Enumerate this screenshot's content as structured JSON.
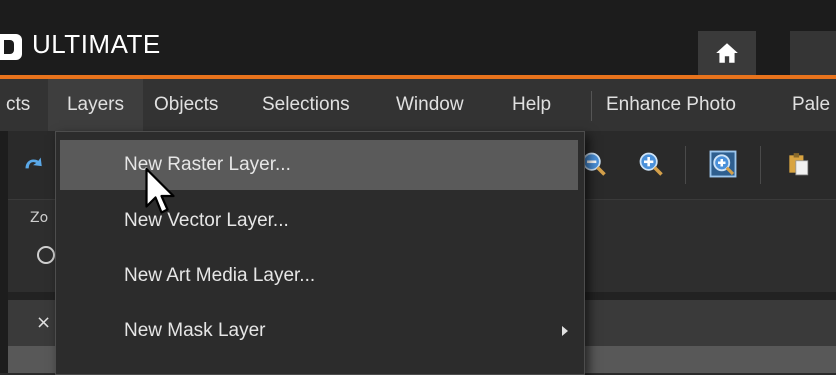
{
  "app": {
    "title": "ULTIMATE",
    "accent_color": "#e8731c",
    "home_icon": "home-icon"
  },
  "menubar": {
    "items": [
      {
        "label": "cts",
        "key": "partial"
      },
      {
        "label": "Layers",
        "key": "layers",
        "active": true
      },
      {
        "label": "Objects",
        "key": "objects"
      },
      {
        "label": "Selections",
        "key": "selections"
      },
      {
        "label": "Window",
        "key": "window"
      },
      {
        "label": "Help",
        "key": "help"
      },
      {
        "label": "Enhance Photo",
        "key": "enhance-photo"
      },
      {
        "label": "Pale",
        "key": "palettes-partial"
      }
    ]
  },
  "toolbar": {
    "icons": [
      "undo-icon",
      "zoom-out-icon",
      "zoom-in-icon",
      "zoom-fit-icon",
      "paste-icon"
    ]
  },
  "options": {
    "zoom_label": "Zo"
  },
  "tabs": {
    "close_glyph": "×"
  },
  "layers_menu": {
    "items": [
      {
        "label": "New Raster Layer...",
        "hover": true
      },
      {
        "label": "New Vector Layer..."
      },
      {
        "label": "New Art Media Layer..."
      },
      {
        "label": "New Mask Layer",
        "submenu": true
      }
    ]
  }
}
